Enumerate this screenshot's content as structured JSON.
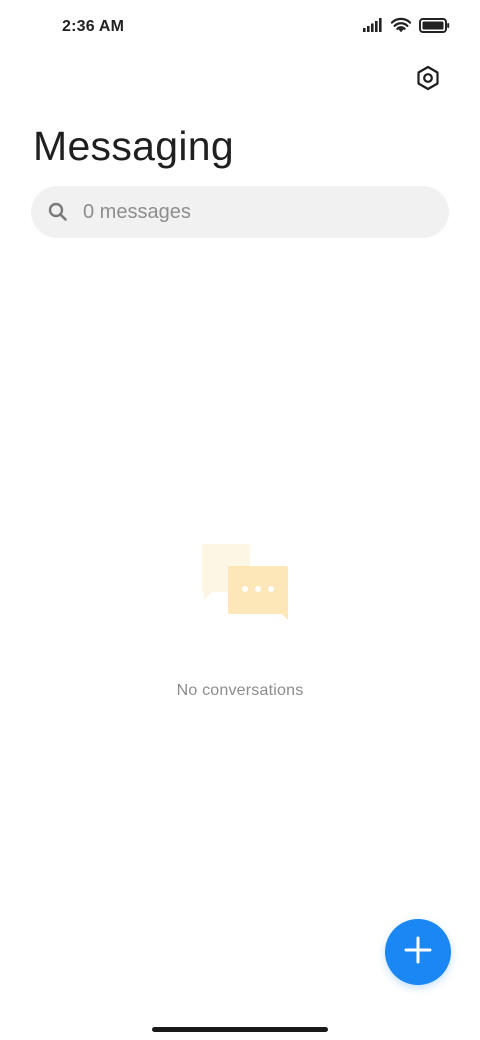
{
  "status_bar": {
    "time": "2:36 AM",
    "icons": [
      "signal-icon",
      "wifi-icon",
      "battery-icon"
    ]
  },
  "header": {
    "settings_icon": "settings-icon",
    "title": "Messaging"
  },
  "search": {
    "icon": "search-icon",
    "placeholder": "0 messages",
    "value": ""
  },
  "empty_state": {
    "illustration": "chat-bubbles-icon",
    "message": "No conversations"
  },
  "fab": {
    "icon": "plus-icon",
    "color": "#1a87f5"
  },
  "colors": {
    "accent": "#1a87f5",
    "illustration_light": "#fef6e4",
    "illustration_main": "#fde7b8"
  }
}
